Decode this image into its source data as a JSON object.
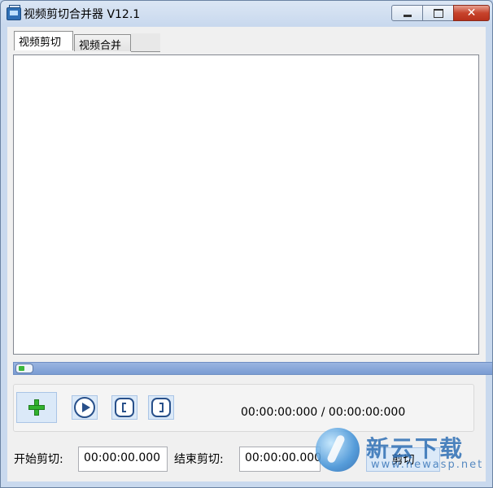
{
  "window": {
    "title": "视频剪切合并器 V12.1"
  },
  "tabs": [
    {
      "label": "视频剪切",
      "selected": true
    },
    {
      "label": "视频合并",
      "selected": false
    }
  ],
  "controls": {
    "time_readout": "00:00:00:000 / 00:00:00:000"
  },
  "cut": {
    "start_label": "开始剪切:",
    "start_value": "00:00:00.000",
    "end_label": "结束剪切:",
    "end_value": "00:00:00.000",
    "go_label": "剪切"
  },
  "progress": {
    "position": 0
  },
  "watermark": {
    "brand": "新云下载",
    "url": "www.newasp.net"
  },
  "colors": {
    "accent": "#7a9cd3",
    "add_green": "#31b22e",
    "icon_blue": "#28508a"
  }
}
